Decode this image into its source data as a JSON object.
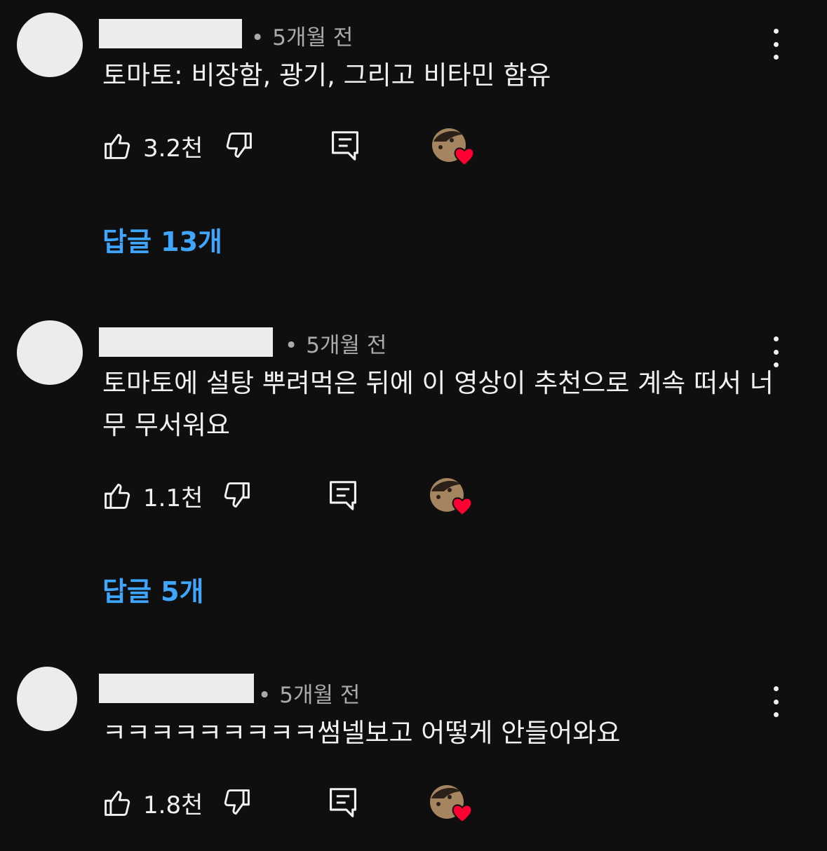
{
  "comments": [
    {
      "time": "5개월 전",
      "dot": "•",
      "text": "토마토: 비장함, 광기, 그리고 비타민 함유",
      "likes": "3.2천",
      "replies": "답글 13개"
    },
    {
      "time": "5개월 전",
      "dot": "•",
      "text": "토마토에 설탕 뿌려먹은 뒤에 이 영상이 추천으로 계속 떠서 너무 무서워요",
      "likes": "1.1천",
      "replies": "답글 5개"
    },
    {
      "time": "5개월 전",
      "dot": "•",
      "text": "ㅋㅋㅋㅋㅋㅋㅋㅋㅋ썸넬보고 어떻게 안들어와요",
      "likes": "1.8천"
    }
  ],
  "icons": {
    "like": "thumbs-up-icon",
    "dislike": "thumbs-down-icon",
    "reply": "reply-icon",
    "creator_heart": "creator-heart-icon",
    "menu": "more-vert-icon"
  },
  "colors": {
    "background": "#0f0f0f",
    "text": "#f1f1f1",
    "secondary_text": "#aaaaaa",
    "link": "#3ea6ff",
    "heart": "#ff0033"
  }
}
